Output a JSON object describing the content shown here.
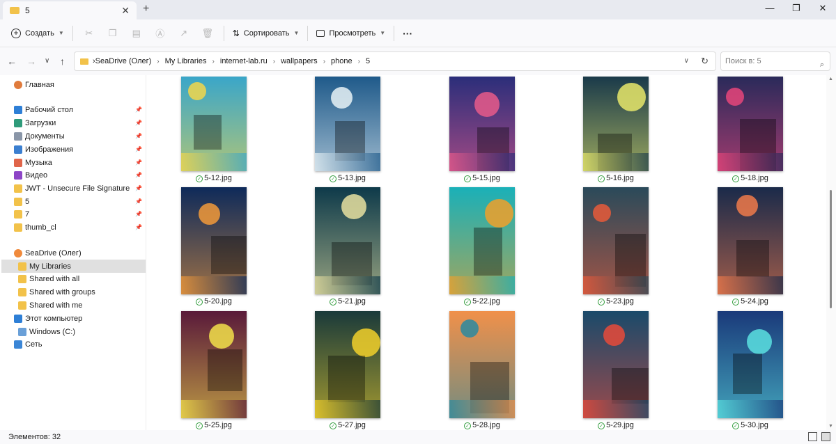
{
  "window": {
    "tab_title": "5",
    "tab_close": "✕",
    "new_tab": "+",
    "minimize": "—",
    "maximize": "❐",
    "close": "✕"
  },
  "toolbar": {
    "create_label": "Создать",
    "sort_label": "Сортировать",
    "view_label": "Просмотреть",
    "more_label": "···"
  },
  "address": {
    "crumbs": [
      "SeaDrive (Олег)",
      "My Libraries",
      "internet-lab.ru",
      "wallpapers",
      "phone",
      "5"
    ],
    "search_placeholder": "Поиск в: 5"
  },
  "sidebar": {
    "items": [
      {
        "label": "Главная",
        "color": "#e07b3c",
        "pinned": false
      },
      {
        "label": "Рабочий стол",
        "color": "#2e7fd6",
        "pinned": true
      },
      {
        "label": "Загрузки",
        "color": "#2f9b7a",
        "pinned": true
      },
      {
        "label": "Документы",
        "color": "#8a96a8",
        "pinned": true
      },
      {
        "label": "Изображения",
        "color": "#3b7fd0",
        "pinned": true
      },
      {
        "label": "Музыка",
        "color": "#e0654a",
        "pinned": true
      },
      {
        "label": "Видео",
        "color": "#8d45c7",
        "pinned": true
      },
      {
        "label": "JWT - Unsecure File Signature",
        "color": "#f2c24a",
        "pinned": true
      },
      {
        "label": "5",
        "color": "#f2c24a",
        "pinned": true
      },
      {
        "label": "7",
        "color": "#f2c24a",
        "pinned": true
      },
      {
        "label": "thumb_cl",
        "color": "#f2c24a",
        "pinned": true
      },
      {
        "label": "SeaDrive (Олег)",
        "color": "#f08a3c",
        "pinned": false
      },
      {
        "label": "My Libraries",
        "color": "#f2c24a",
        "pinned": false
      },
      {
        "label": "Shared with all",
        "color": "#f2c24a",
        "pinned": false
      },
      {
        "label": "Shared with groups",
        "color": "#f2c24a",
        "pinned": false
      },
      {
        "label": "Shared with me",
        "color": "#f2c24a",
        "pinned": false
      },
      {
        "label": "Этот компьютер",
        "color": "#2e7fd6",
        "pinned": false
      },
      {
        "label": "Windows  (C:)",
        "color": "#6aa0d8",
        "pinned": false
      },
      {
        "label": "Сеть",
        "color": "#3b86d6",
        "pinned": false
      }
    ]
  },
  "files": [
    {
      "name": "5-12.jpg",
      "bg": "#3aa6c9",
      "accent": "#f2d64b"
    },
    {
      "name": "5-13.jpg",
      "bg": "#1f5a8a",
      "accent": "#e8f2f6"
    },
    {
      "name": "5-15.jpg",
      "bg": "#2b2e7a",
      "accent": "#e85a8a"
    },
    {
      "name": "5-16.jpg",
      "bg": "#1a3a4a",
      "accent": "#e8e86a"
    },
    {
      "name": "5-18.jpg",
      "bg": "#2a2a5a",
      "accent": "#e8457a"
    },
    {
      "name": "5-20.jpg",
      "bg": "#0e2a5a",
      "accent": "#f29a3a"
    },
    {
      "name": "5-21.jpg",
      "bg": "#0e3a4a",
      "accent": "#e8e0a0"
    },
    {
      "name": "5-22.jpg",
      "bg": "#1ab0b8",
      "accent": "#f0a02a"
    },
    {
      "name": "5-23.jpg",
      "bg": "#2a4a5a",
      "accent": "#e85a3a"
    },
    {
      "name": "5-24.jpg",
      "bg": "#1a2a4a",
      "accent": "#f07a4a"
    },
    {
      "name": "5-25.jpg",
      "bg": "#5a1a3a",
      "accent": "#f2e04a"
    },
    {
      "name": "5-27.jpg",
      "bg": "#1a3a3a",
      "accent": "#f2d02a"
    },
    {
      "name": "5-28.jpg",
      "bg": "#f0904a",
      "accent": "#2a8aa0"
    },
    {
      "name": "5-29.jpg",
      "bg": "#1a4a6a",
      "accent": "#e84a3a"
    },
    {
      "name": "5-30.jpg",
      "bg": "#1a3a7a",
      "accent": "#5ae0e0"
    }
  ],
  "status": {
    "items_count": "Элементов: 32"
  }
}
